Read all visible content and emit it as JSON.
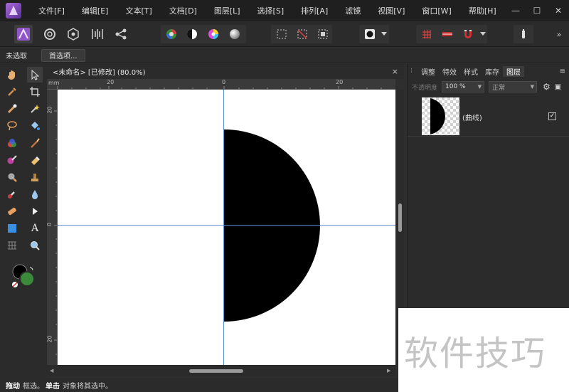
{
  "menu": [
    "文件[F]",
    "编辑[E]",
    "文本[T]",
    "文档[D]",
    "图层[L]",
    "选择[S]",
    "排列[A]",
    "滤镜",
    "视图[V]",
    "窗口[W]",
    "帮助[H]"
  ],
  "context_bar": {
    "selection_label": "未选取",
    "preferences_button": "首选项..."
  },
  "document": {
    "tab_title": "<未命名> [已修改] (80.0%)",
    "close": "×"
  },
  "rulers": {
    "unit": "mm",
    "h_labels": [
      "20",
      "0",
      "20"
    ],
    "v_labels": [
      "20",
      "0",
      "20"
    ]
  },
  "panel": {
    "tabs": [
      "调整",
      "特效",
      "样式",
      "库存",
      "图层"
    ],
    "active_tab": "图层",
    "opacity_label": "不透明度",
    "opacity_value": "100 %",
    "blend_mode": "正常",
    "layer_name": "(曲线)",
    "layer_visible": "✓"
  },
  "status": {
    "drag_label": "拖动",
    "drag_text": "框选。",
    "click_label": "单击",
    "click_text": "对象将其选中。"
  },
  "watermark": "软件技巧",
  "colors": {
    "primary_color": "#000000",
    "secondary_color": "#3a8a3a",
    "guide_color": "#5b8fd1"
  }
}
